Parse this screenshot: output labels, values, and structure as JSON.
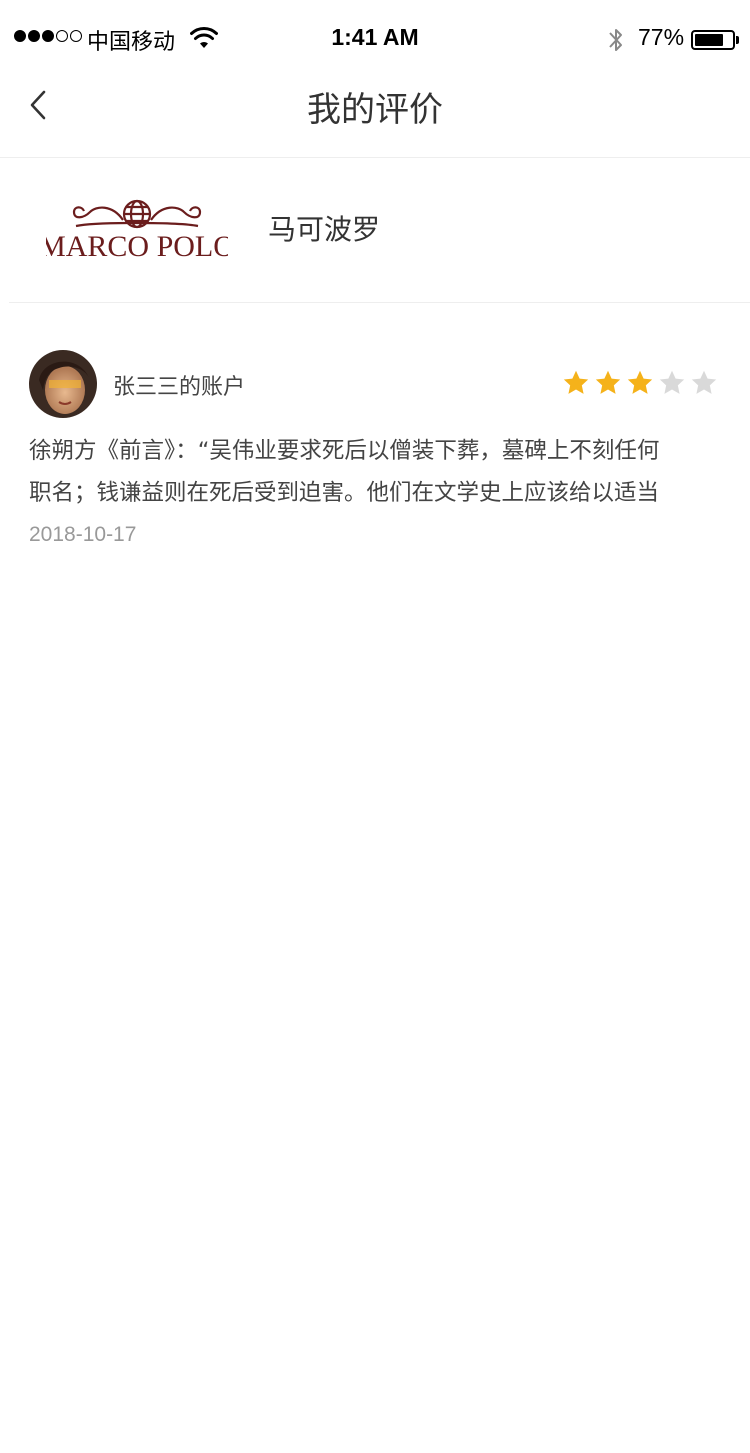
{
  "status_bar": {
    "carrier": "中国移动",
    "time": "1:41 AM",
    "battery_percent": "77%",
    "battery_level": 0.77,
    "signal_bars_filled": 3,
    "signal_bars_total": 5
  },
  "nav": {
    "title": "我的评价",
    "back_icon": "chevron-left-icon"
  },
  "store": {
    "logo_text": "MARCO POLO",
    "name": "马可波罗"
  },
  "review": {
    "username": "张三三的账户",
    "rating": 3,
    "max_rating": 5,
    "text_line1": "徐朔方《前言》：“吴伟业要求死后以僧装下葬，墓碑上不刻任何",
    "text_line2": "职名；钱谦益则在死后受到迫害。他们在文学史上应该给以适当",
    "date": "2018-10-17"
  },
  "colors": {
    "star_active": "#F5B21A",
    "star_inactive": "#D9D9D9",
    "logo": "#6B1D1D"
  }
}
